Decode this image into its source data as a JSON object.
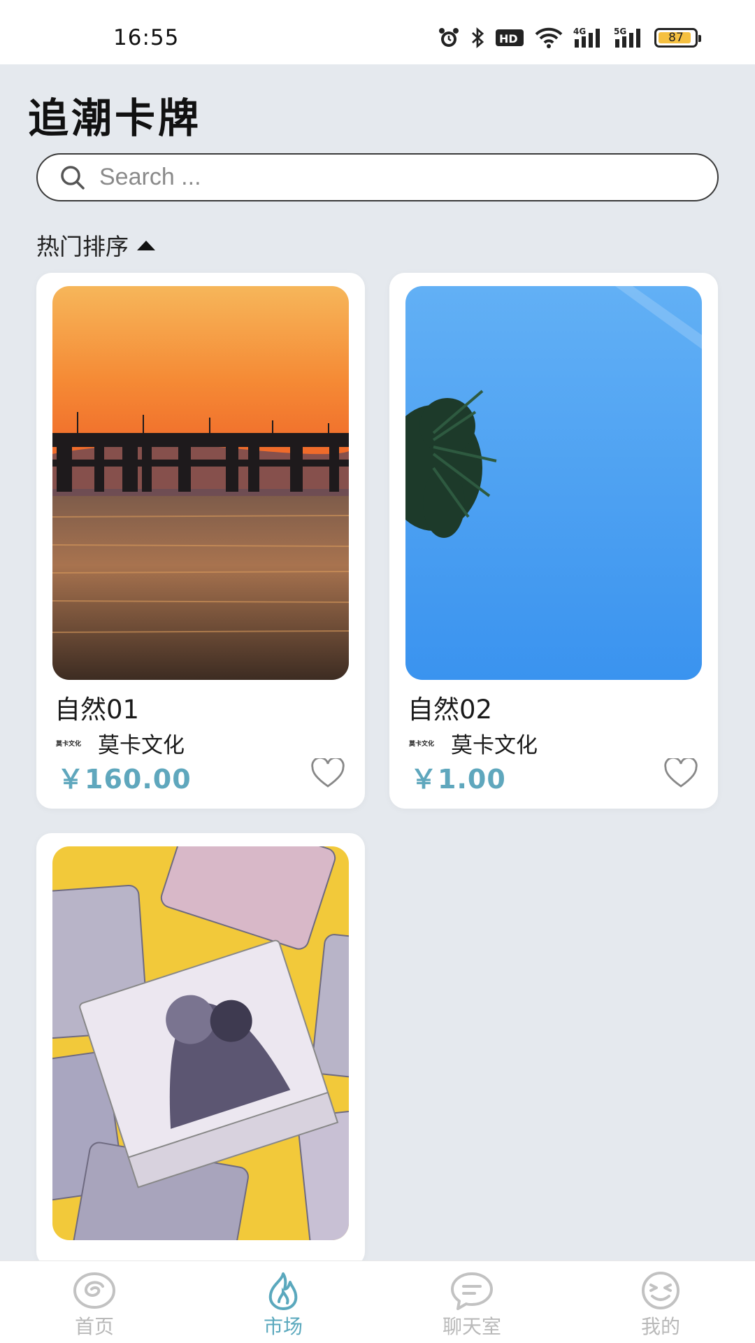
{
  "status_bar": {
    "time": "16:55",
    "network_hd": "HD",
    "signal_1": "4G",
    "signal_2": "5G",
    "battery": "87"
  },
  "header": {
    "title": "追潮卡牌"
  },
  "search": {
    "placeholder": "Search ..."
  },
  "sort": {
    "label": "热门排序"
  },
  "products": [
    {
      "name": "自然01",
      "brand_logo": "莫卡文化",
      "brand": "莫卡文化",
      "price": "￥160.00"
    },
    {
      "name": "自然02",
      "brand_logo": "莫卡文化",
      "brand": "莫卡文化",
      "price": "￥1.00"
    },
    {
      "name": "",
      "brand_logo": "",
      "brand": "",
      "price": ""
    }
  ],
  "tabbar": {
    "items": [
      {
        "label": "首页",
        "icon": "home-swirl-icon"
      },
      {
        "label": "市场",
        "icon": "flame-icon"
      },
      {
        "label": "聊天室",
        "icon": "chat-bubble-icon"
      },
      {
        "label": "我的",
        "icon": "smiley-face-icon"
      }
    ],
    "active_color": "#5aa8bd",
    "inactive_color": "#b9b9b9"
  },
  "accent_color": "#5fa7bd"
}
